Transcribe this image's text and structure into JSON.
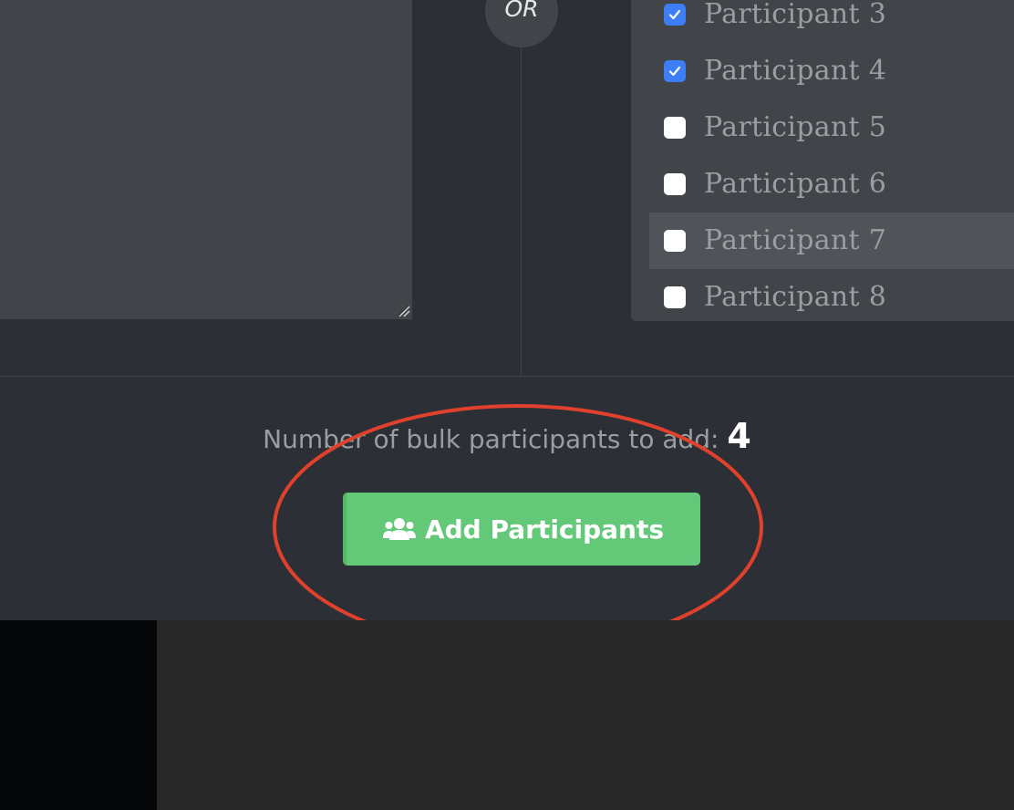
{
  "or_divider": {
    "label": "OR"
  },
  "participants": [
    {
      "label": "Participant 3",
      "checked": true
    },
    {
      "label": "Participant 4",
      "checked": true
    },
    {
      "label": "Participant 5",
      "checked": false
    },
    {
      "label": "Participant 6",
      "checked": false
    },
    {
      "label": "Participant 7",
      "checked": false,
      "hovered": true
    },
    {
      "label": "Participant 8",
      "checked": false
    }
  ],
  "bulk": {
    "label": "Number of bulk participants to add:",
    "count": "4"
  },
  "add_button": {
    "label": "Add Participants",
    "icon": "users-icon"
  },
  "colors": {
    "accent_checkbox": "#3d7ef7",
    "button_green": "#63c979",
    "annotation_red": "#e0412c",
    "panel_bg": "#2c2f35",
    "input_bg": "#414549"
  }
}
